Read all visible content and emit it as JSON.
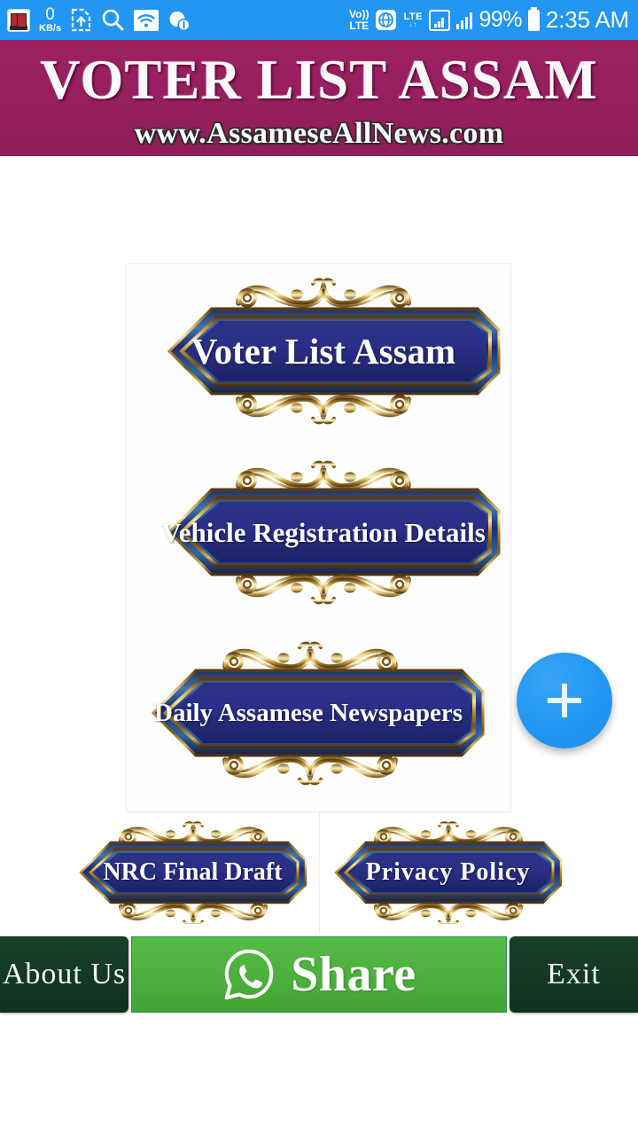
{
  "statusbar": {
    "app_icon": "book-app-icon",
    "network_speed_value": "0",
    "network_speed_unit": "KB/s",
    "sim_icon": "sim-card-upload-icon",
    "search_icon": "search-icon",
    "wifi_icon": "wifi-icon",
    "data_saver_icon": "data-saver-icon",
    "volte_line1": "Vo))",
    "volte_line2": "LTE",
    "sim_globe_icon": "sim-globe-icon",
    "lte_label": "LTE",
    "lte_arrows": "↓↑",
    "signal_box_icon": "signal-box-icon",
    "signal_bars_icon": "signal-bars-icon",
    "battery_percent": "99%",
    "battery_icon": "battery-full-icon",
    "clock": "2:35 AM"
  },
  "header": {
    "title": "VOTER LIST ASSAM",
    "subtitle": "www.AssameseAllNews.com",
    "background_color": "#9c2061"
  },
  "main": {
    "buttons": [
      {
        "label": "Voter List Assam"
      },
      {
        "label": "Vehicle Registration Details"
      },
      {
        "label": "Daily Assamese Newspapers"
      }
    ],
    "secondary_buttons": [
      {
        "label": "NRC Final Draft"
      },
      {
        "label": "Privacy  Policy"
      }
    ],
    "fab": {
      "icon": "plus-icon",
      "color": "#2196f3"
    }
  },
  "bottombar": {
    "about_label": "About  Us",
    "share_label": "Share",
    "share_icon": "whatsapp-icon",
    "exit_label": "Exit",
    "share_color": "#4caf3c",
    "dark_color": "#143b22"
  }
}
